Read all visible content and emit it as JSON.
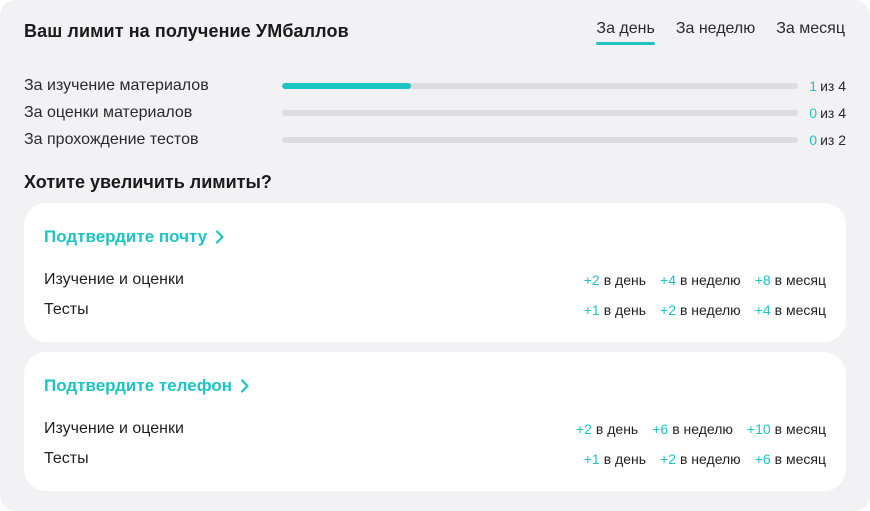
{
  "header": {
    "title": "Ваш лимит на получение УМбаллов",
    "tabs": [
      {
        "label": "За день",
        "active": true
      },
      {
        "label": "За неделю",
        "active": false
      },
      {
        "label": "За месяц",
        "active": false
      }
    ]
  },
  "limits": [
    {
      "label": "За изучение материалов",
      "current": "1",
      "of": "из 4",
      "progress": 0.25
    },
    {
      "label": "За оценки материалов",
      "current": "0",
      "of": "из 4",
      "progress": 0
    },
    {
      "label": "За прохождение тестов",
      "current": "0",
      "of": "из 2",
      "progress": 0
    }
  ],
  "increase_title": "Хотите увеличить лимиты?",
  "cards": [
    {
      "title": "Подтвердите почту",
      "rows": [
        {
          "name": "Изучение и оценки",
          "day": "+2",
          "week": "+4",
          "month": "+8"
        },
        {
          "name": "Тесты",
          "day": "+1",
          "week": "+2",
          "month": "+4"
        }
      ]
    },
    {
      "title": "Подтвердите телефон",
      "rows": [
        {
          "name": "Изучение и оценки",
          "day": "+2",
          "week": "+6",
          "month": "+10"
        },
        {
          "name": "Тесты",
          "day": "+1",
          "week": "+2",
          "month": "+6"
        }
      ]
    }
  ],
  "units": {
    "day": "в день",
    "week": "в неделю",
    "month": "в месяц"
  },
  "colors": {
    "accent": "#1ec3c3",
    "track": "#dcdce2",
    "panel": "#f2f2f4"
  }
}
